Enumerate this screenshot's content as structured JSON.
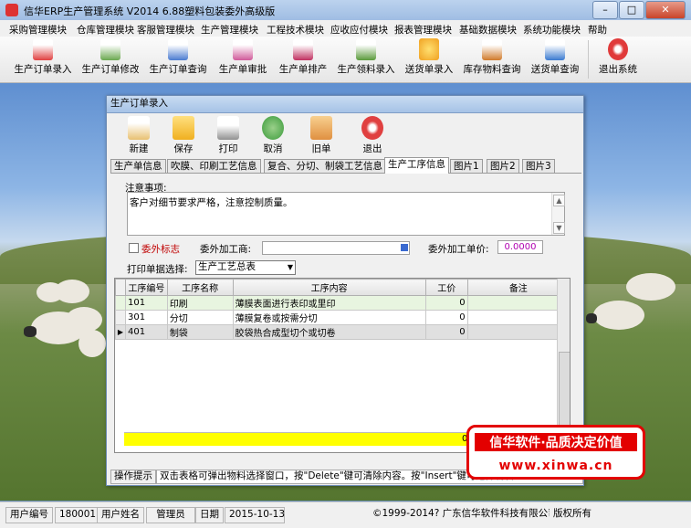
{
  "window": {
    "title": "信华ERP生产管理系统  V2014  6.88塑料包装委外高级版",
    "minimize_glyph": "–",
    "maximize_glyph": "□",
    "close_glyph": "✕"
  },
  "menu": [
    "采购管理模块",
    "仓库管理模块",
    "客服管理模块",
    "生产管理模块",
    "工程技术模块",
    "应收应付模块",
    "报表管理模块",
    "基础数据模块",
    "系统功能模块",
    "帮助"
  ],
  "toolbar": [
    {
      "label": "生产订单录入",
      "icon": "document-icon",
      "color": "#e04040"
    },
    {
      "label": "生产订单修改",
      "icon": "edit-icon",
      "color": "#6aa84f"
    },
    {
      "label": "生产订单查询",
      "icon": "search-icon",
      "color": "#4a7bd0"
    },
    {
      "label": "生产单审批",
      "icon": "approve-icon",
      "color": "#d05a9a"
    },
    {
      "label": "生产单排产",
      "icon": "schedule-icon",
      "color": "#c03060"
    },
    {
      "label": "生产领料录入",
      "icon": "material-icon",
      "color": "#5a9a3a"
    },
    {
      "label": "送货单录入",
      "icon": "delivery-icon",
      "color": "#f0a020"
    },
    {
      "label": "库存物料查询",
      "icon": "inventory-icon",
      "color": "#d07a2a"
    },
    {
      "label": "送货单查询",
      "icon": "delivery-search-icon",
      "color": "#3a7ad0"
    },
    {
      "label": "退出系统",
      "icon": "exit-icon",
      "color": "#e03a3a"
    }
  ],
  "dialog": {
    "title": "生产订单录入",
    "toolbar": [
      {
        "label": "新建",
        "icon": "new-icon",
        "color": "#e8c070"
      },
      {
        "label": "保存",
        "icon": "save-icon",
        "color": "#f0b020"
      },
      {
        "label": "打印",
        "icon": "print-icon",
        "color": "#909090"
      },
      {
        "label": "取消",
        "icon": "cancel-icon",
        "color": "#3a9a3a"
      },
      {
        "label": "旧单",
        "icon": "old-order-icon",
        "color": "#e09040"
      },
      {
        "label": "退出",
        "icon": "exit-icon",
        "color": "#e04040"
      }
    ],
    "tabs": [
      "生产单信息",
      "吹膜、印刷工艺信息",
      "复合、分切、制袋工艺信息",
      "生产工序信息",
      "图片1",
      "图片2",
      "图片3"
    ],
    "active_tab": 3,
    "notes_label": "注意事项:",
    "notes_text": "客户对细节要求严格，注意控制质量。",
    "outsource_flag_label": "委外标志",
    "outsource_vendor_label": "委外加工商:",
    "outsource_price_label": "委外加工单价:",
    "outsource_price_value": "0.0000",
    "print_select_label": "打印单据选择:",
    "print_select_value": "生产工艺总表",
    "grid_headers": [
      "工序编号",
      "工序名称",
      "工序内容",
      "工价",
      "备注"
    ],
    "grid_rows": [
      {
        "code": "101",
        "name": "印刷",
        "content": "薄膜表面进行表印或里印",
        "price": "0",
        "note": ""
      },
      {
        "code": "301",
        "name": "分切",
        "content": "薄膜复卷或按需分切",
        "price": "0",
        "note": ""
      },
      {
        "code": "401",
        "name": "制袋",
        "content": "胶袋热合成型切个或切卷",
        "price": "0",
        "note": ""
      }
    ],
    "grid_total": "0",
    "hint_label": "操作提示",
    "hint_text": "双击表格可弹出物料选择窗口，按\"Delete\"键可清除内容。按\"Insert\"键可选择物料"
  },
  "promo": {
    "line1": "信华软件·品质决定价值",
    "line2": "www.xinwa.cn"
  },
  "status": {
    "user_id_label": "用户编号",
    "user_id": "180001",
    "user_name_label": "用户姓名",
    "user_name": "管理员",
    "date_label": "日期",
    "date": "2015-10-13",
    "copyright": "©1999-2014?  广东信华软件科技有限公司",
    "rights": "版权所有"
  }
}
